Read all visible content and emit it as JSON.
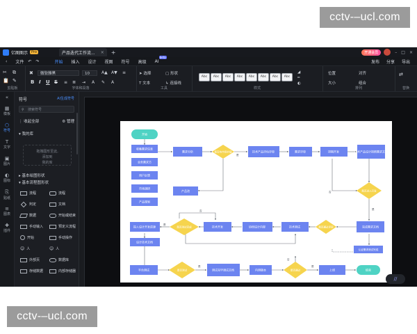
{
  "watermarks": {
    "top": "cctv-–ucl.com",
    "bottom": "cctv-–ucl.com"
  },
  "titlebar": {
    "app_name": "亿图图示",
    "pro_badge": "Pro",
    "doc_tab": "产品迭代工作流...",
    "close": "×",
    "new_tab": "+",
    "member_button": "开通会员",
    "min": "–",
    "max": "□",
    "close_win": "×"
  },
  "menubar": {
    "items": [
      "文件",
      "开始",
      "插入",
      "设计",
      "视图",
      "符号",
      "高级",
      "AI"
    ],
    "active": "开始",
    "ai_badge": "beta",
    "right": [
      "发布",
      "分享",
      "导出"
    ]
  },
  "ribbon": {
    "clipboard_label": "剪贴板",
    "font": "微软雅黑",
    "font_size": "10",
    "font_label": "字体和段落",
    "tools": {
      "select": "选择",
      "shape": "形状",
      "text": "文本",
      "connector": "连接线",
      "label": "工具"
    },
    "style_swatch": "Abc",
    "style_label": "样式",
    "arrange": {
      "position": "位置",
      "align": "对齐",
      "size": "大小",
      "group": "组合",
      "label": "排列"
    },
    "replace": {
      "text": "替换",
      "label": "替换"
    }
  },
  "iconbar": [
    {
      "icon": "«",
      "label": ""
    },
    {
      "icon": "▦",
      "label": "模板"
    },
    {
      "icon": "⬡",
      "label": "符号"
    },
    {
      "icon": "T",
      "label": "文字"
    },
    {
      "icon": "▣",
      "label": "图片"
    },
    {
      "icon": "◐",
      "label": "图标"
    },
    {
      "icon": "⎘",
      "label": "贴纸"
    },
    {
      "icon": "≡",
      "label": "图表"
    },
    {
      "icon": "✚",
      "label": "插件"
    }
  ],
  "symbol_panel": {
    "title": "符号",
    "ai_link": "AI生成符号",
    "search_placeholder": "搜索符号",
    "collapse_all": "收起全部",
    "manage": "管理",
    "my_library": "我的库",
    "empty_hint_1": "拖拽图形至此,",
    "empty_hint_2": "添加到",
    "empty_hint_3": "我的库",
    "basic_shapes": "基本绘图形状",
    "basic_flowchart": "基本流程图形状",
    "symbols": [
      "流程",
      "流程",
      "判定",
      "文档",
      "数据",
      "开始或结束",
      "手动输入",
      "预定义流程",
      "开始",
      "手动操作",
      "人",
      "人",
      "外部页",
      "数据库",
      "存储数据",
      "内部存储器"
    ]
  },
  "flowchart": {
    "start": "开始",
    "end": "结束",
    "nodes": {
      "collect": "收集需求信息",
      "analyze": "需求分析",
      "pm": "业务需求方",
      "user": "用户反馈",
      "market": "市场调研",
      "product": "产品规划",
      "pool": "产品池",
      "tech_eval": "技术产品评估评审",
      "review": "需求评审",
      "schedule": "排期开发",
      "tech_doc": "技术产品设计按照需求文档",
      "design": "技术开发",
      "tech_review": "技术测试",
      "dev_req": "投入设计开发资源",
      "doc_plan": "设计技术文档",
      "deploy": "协同设计内容",
      "fix": "完成需求文档",
      "report": "认证需求测试完成",
      "release": "平台测试",
      "launch": "测试完毕调试文档",
      "verify": "内测版本",
      "online": "上线"
    },
    "decisions": {
      "d1": "是否有市场价值",
      "d2": "是否进入开发",
      "d3": "是否通过评审",
      "d4": "是否测试完成",
      "d5": "是否通过测试",
      "d6": "是否测试",
      "d7": "是否通过"
    },
    "edge_labels": {
      "yes": "是",
      "no": "否"
    }
  },
  "colors": {
    "node": "#6c84f0",
    "decision": "#f6d44e",
    "terminal": "#4fd3c4",
    "accent": "#4a90ff"
  }
}
